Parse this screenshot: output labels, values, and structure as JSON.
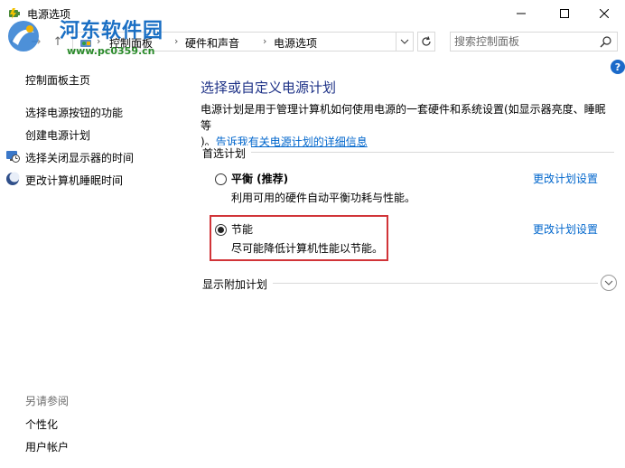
{
  "window": {
    "title": "电源选项",
    "minimize_icon": "minimize-icon",
    "maximize_icon": "maximize-icon",
    "close_icon": "close-icon"
  },
  "nav": {
    "back_icon": "back-arrow-icon",
    "forward_icon": "forward-arrow-icon",
    "up_icon": "up-arrow-icon"
  },
  "address": {
    "crumbs": [
      "控制面板",
      "硬件和声音",
      "电源选项"
    ],
    "dropdown_icon": "chevron-down-icon",
    "refresh_icon": "refresh-icon"
  },
  "search": {
    "placeholder": "搜索控制面板",
    "icon": "search-icon"
  },
  "watermark": {
    "title": "河东软件园",
    "url": "www.pc0359.cn"
  },
  "help": {
    "label": "?"
  },
  "sidebar": {
    "home": "控制面板主页",
    "items": [
      {
        "label": "选择电源按钮的功能",
        "icon": ""
      },
      {
        "label": "创建电源计划",
        "icon": ""
      },
      {
        "label": "选择关闭显示器的时间",
        "icon": "monitor-clock-icon"
      },
      {
        "label": "更改计算机睡眠时间",
        "icon": "moon-sleep-icon"
      }
    ],
    "see_also": {
      "title": "另请参阅",
      "links": [
        "个性化",
        "用户帐户"
      ]
    }
  },
  "main": {
    "heading": "选择或自定义电源计划",
    "description": "电源计划是用于管理计算机如何使用电源的一套硬件和系统设置(如显示器亮度、睡眠等",
    "description_tail": ")。",
    "description_link": "告诉我有关电源计划的详细信息",
    "preferred_label": "首选计划",
    "plans": [
      {
        "name": "平衡 (推荐)",
        "description": "利用可用的硬件自动平衡功耗与性能。",
        "change_link": "更改计划设置",
        "selected": false
      },
      {
        "name": "节能",
        "description": "尽可能降低计算机性能以节能。",
        "change_link": "更改计划设置",
        "selected": true
      }
    ],
    "additional_label": "显示附加计划",
    "expand_icon": "chevron-down-circle-icon",
    "highlight_color": "#d13438"
  },
  "colors": {
    "heading": "#1e3287",
    "link": "#0066cc",
    "watermark_title": "#1a6fc4",
    "watermark_url": "#2a8a2a"
  }
}
